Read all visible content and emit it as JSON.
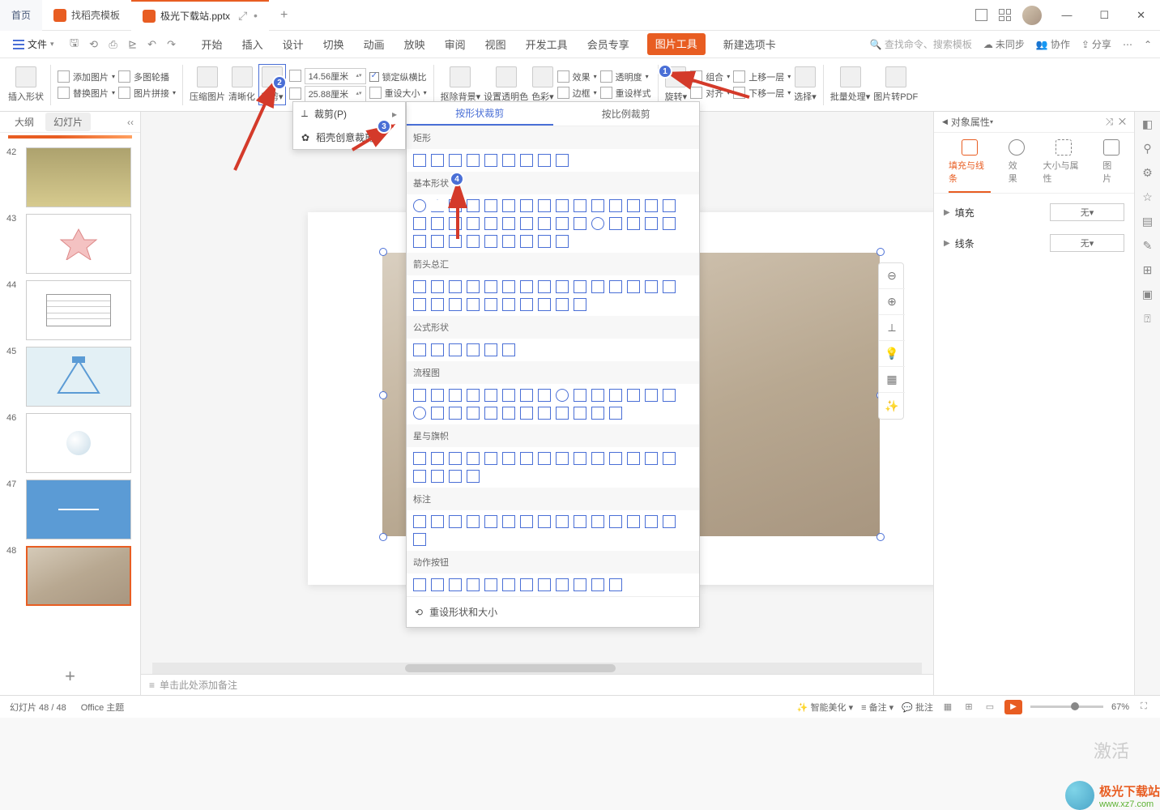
{
  "titleBar": {
    "home": "首页",
    "template": "找稻壳模板",
    "doc": "极光下载站.pptx",
    "add": "+"
  },
  "ribbonRow": {
    "file": "文件",
    "tabs": [
      "开始",
      "插入",
      "设计",
      "切换",
      "动画",
      "放映",
      "审阅",
      "视图",
      "开发工具",
      "会员专享",
      "图片工具",
      "新建选项卡"
    ],
    "searchPlaceholder": "查找命令、搜索模板",
    "sync": "未同步",
    "coop": "协作",
    "share": "分享"
  },
  "toolbar": {
    "insertShape": "插入形状",
    "addImage": "添加图片",
    "multiContour": "多图轮播",
    "replaceImage": "替换图片",
    "imageTile": "图片拼接",
    "compress": "压缩图片",
    "clarify": "清晰化",
    "crop": "裁剪",
    "width": "14.56厘米",
    "height": "25.88厘米",
    "lockRatio": "锁定纵横比",
    "resetSize": "重设大小",
    "removeBg": "抠除背景",
    "setTransColor": "设置透明色",
    "color": "色彩",
    "effect": "效果",
    "transparency": "透明度",
    "border": "边框",
    "resetStyle": "重设样式",
    "rotate": "旋转",
    "combine": "组合",
    "align": "对齐",
    "moveUp": "上移一层",
    "moveDown": "下移一层",
    "select": "选择",
    "batch": "批量处理",
    "toPdf": "图片转PDF"
  },
  "dropdown": {
    "cropP": "裁剪(P)",
    "creative": "稻壳创意裁剪"
  },
  "shapePanel": {
    "tab1": "按形状裁剪",
    "tab2": "按比例裁剪",
    "sections": [
      "矩形",
      "基本形状",
      "箭头总汇",
      "公式形状",
      "流程图",
      "星与旗帜",
      "标注",
      "动作按钮"
    ],
    "reset": "重设形状和大小"
  },
  "outline": {
    "tab1": "大纲",
    "tab2": "幻灯片",
    "nums": [
      "42",
      "43",
      "44",
      "45",
      "46",
      "47",
      "48"
    ],
    "add": "+"
  },
  "notes": "单击此处添加备注",
  "propPanel": {
    "title": "对象属性",
    "tabs": [
      "填充与线条",
      "效果",
      "大小与属性",
      "图片"
    ],
    "fill": "填充",
    "fillVal": "无",
    "line": "线条",
    "lineVal": "无"
  },
  "statusBar": {
    "slideInfo": "幻灯片 48 / 48",
    "theme": "Office 主题",
    "beautify": "智能美化",
    "notes": "备注",
    "comments": "批注",
    "zoom": "67%"
  },
  "badges": {
    "1": "1",
    "2": "2",
    "3": "3",
    "4": "4"
  },
  "watermark": {
    "name": "极光下载站",
    "url": "www.xz7.com"
  },
  "activation": "激活"
}
